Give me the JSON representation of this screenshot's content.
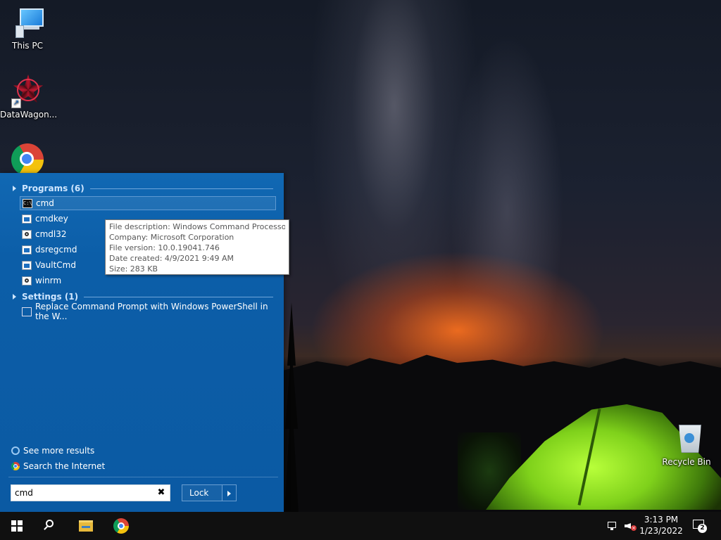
{
  "desktop": {
    "icons": [
      {
        "label": "This PC",
        "icon": "this-pc-icon"
      },
      {
        "label": "DataWagon...",
        "icon": "datawagon-app-icon"
      },
      {
        "label": "",
        "icon": "chrome-icon"
      },
      {
        "label": "Recycle Bin",
        "icon": "recycle-bin-icon"
      }
    ]
  },
  "search_panel": {
    "groups": {
      "programs": "Programs (6)",
      "settings": "Settings (1)"
    },
    "programs": [
      {
        "label": "cmd",
        "icon": "cmd-icon",
        "selected": true
      },
      {
        "label": "cmdkey",
        "icon": "exe-icon"
      },
      {
        "label": "cmdl32",
        "icon": "cmdl32-icon"
      },
      {
        "label": "dsregcmd",
        "icon": "exe-icon"
      },
      {
        "label": "VaultCmd",
        "icon": "exe-icon"
      },
      {
        "label": "winrm",
        "icon": "winrm-icon"
      }
    ],
    "settings": [
      {
        "label": "Replace Command Prompt with Windows PowerShell in the W...",
        "icon": "settings-icon"
      }
    ],
    "see_more": "See more results",
    "search_internet": "Search the Internet",
    "query": "cmd",
    "clear_glyph": "✖",
    "lock_label": "Lock"
  },
  "tooltip": {
    "description": "File description: Windows Command Processor",
    "company": "Company: Microsoft Corporation",
    "version": "File version: 10.0.19041.746",
    "created": "Date created: 4/9/2021 9:49 AM",
    "size": "Size: 283 KB"
  },
  "taskbar": {
    "time": "3:13 PM",
    "date": "1/23/2022",
    "notification_count": "2",
    "cmd_icon_text": "C:\\."
  }
}
